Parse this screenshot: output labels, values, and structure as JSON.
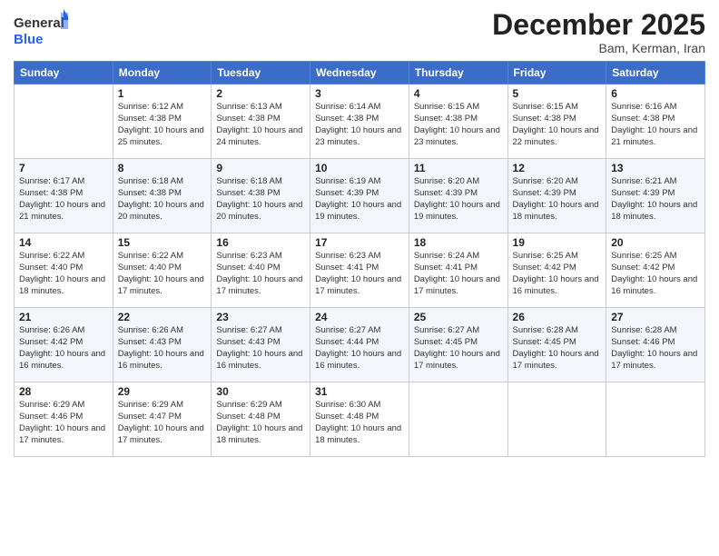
{
  "header": {
    "logo_line1": "General",
    "logo_line2": "Blue",
    "month_title": "December 2025",
    "location": "Bam, Kerman, Iran"
  },
  "weekdays": [
    "Sunday",
    "Monday",
    "Tuesday",
    "Wednesday",
    "Thursday",
    "Friday",
    "Saturday"
  ],
  "weeks": [
    [
      {
        "day": "",
        "sunrise": "",
        "sunset": "",
        "daylight": ""
      },
      {
        "day": "1",
        "sunrise": "6:12 AM",
        "sunset": "4:38 PM",
        "daylight": "10 hours and 25 minutes."
      },
      {
        "day": "2",
        "sunrise": "6:13 AM",
        "sunset": "4:38 PM",
        "daylight": "10 hours and 24 minutes."
      },
      {
        "day": "3",
        "sunrise": "6:14 AM",
        "sunset": "4:38 PM",
        "daylight": "10 hours and 23 minutes."
      },
      {
        "day": "4",
        "sunrise": "6:15 AM",
        "sunset": "4:38 PM",
        "daylight": "10 hours and 23 minutes."
      },
      {
        "day": "5",
        "sunrise": "6:15 AM",
        "sunset": "4:38 PM",
        "daylight": "10 hours and 22 minutes."
      },
      {
        "day": "6",
        "sunrise": "6:16 AM",
        "sunset": "4:38 PM",
        "daylight": "10 hours and 21 minutes."
      }
    ],
    [
      {
        "day": "7",
        "sunrise": "6:17 AM",
        "sunset": "4:38 PM",
        "daylight": "10 hours and 21 minutes."
      },
      {
        "day": "8",
        "sunrise": "6:18 AM",
        "sunset": "4:38 PM",
        "daylight": "10 hours and 20 minutes."
      },
      {
        "day": "9",
        "sunrise": "6:18 AM",
        "sunset": "4:38 PM",
        "daylight": "10 hours and 20 minutes."
      },
      {
        "day": "10",
        "sunrise": "6:19 AM",
        "sunset": "4:39 PM",
        "daylight": "10 hours and 19 minutes."
      },
      {
        "day": "11",
        "sunrise": "6:20 AM",
        "sunset": "4:39 PM",
        "daylight": "10 hours and 19 minutes."
      },
      {
        "day": "12",
        "sunrise": "6:20 AM",
        "sunset": "4:39 PM",
        "daylight": "10 hours and 18 minutes."
      },
      {
        "day": "13",
        "sunrise": "6:21 AM",
        "sunset": "4:39 PM",
        "daylight": "10 hours and 18 minutes."
      }
    ],
    [
      {
        "day": "14",
        "sunrise": "6:22 AM",
        "sunset": "4:40 PM",
        "daylight": "10 hours and 18 minutes."
      },
      {
        "day": "15",
        "sunrise": "6:22 AM",
        "sunset": "4:40 PM",
        "daylight": "10 hours and 17 minutes."
      },
      {
        "day": "16",
        "sunrise": "6:23 AM",
        "sunset": "4:40 PM",
        "daylight": "10 hours and 17 minutes."
      },
      {
        "day": "17",
        "sunrise": "6:23 AM",
        "sunset": "4:41 PM",
        "daylight": "10 hours and 17 minutes."
      },
      {
        "day": "18",
        "sunrise": "6:24 AM",
        "sunset": "4:41 PM",
        "daylight": "10 hours and 17 minutes."
      },
      {
        "day": "19",
        "sunrise": "6:25 AM",
        "sunset": "4:42 PM",
        "daylight": "10 hours and 16 minutes."
      },
      {
        "day": "20",
        "sunrise": "6:25 AM",
        "sunset": "4:42 PM",
        "daylight": "10 hours and 16 minutes."
      }
    ],
    [
      {
        "day": "21",
        "sunrise": "6:26 AM",
        "sunset": "4:42 PM",
        "daylight": "10 hours and 16 minutes."
      },
      {
        "day": "22",
        "sunrise": "6:26 AM",
        "sunset": "4:43 PM",
        "daylight": "10 hours and 16 minutes."
      },
      {
        "day": "23",
        "sunrise": "6:27 AM",
        "sunset": "4:43 PM",
        "daylight": "10 hours and 16 minutes."
      },
      {
        "day": "24",
        "sunrise": "6:27 AM",
        "sunset": "4:44 PM",
        "daylight": "10 hours and 16 minutes."
      },
      {
        "day": "25",
        "sunrise": "6:27 AM",
        "sunset": "4:45 PM",
        "daylight": "10 hours and 17 minutes."
      },
      {
        "day": "26",
        "sunrise": "6:28 AM",
        "sunset": "4:45 PM",
        "daylight": "10 hours and 17 minutes."
      },
      {
        "day": "27",
        "sunrise": "6:28 AM",
        "sunset": "4:46 PM",
        "daylight": "10 hours and 17 minutes."
      }
    ],
    [
      {
        "day": "28",
        "sunrise": "6:29 AM",
        "sunset": "4:46 PM",
        "daylight": "10 hours and 17 minutes."
      },
      {
        "day": "29",
        "sunrise": "6:29 AM",
        "sunset": "4:47 PM",
        "daylight": "10 hours and 17 minutes."
      },
      {
        "day": "30",
        "sunrise": "6:29 AM",
        "sunset": "4:48 PM",
        "daylight": "10 hours and 18 minutes."
      },
      {
        "day": "31",
        "sunrise": "6:30 AM",
        "sunset": "4:48 PM",
        "daylight": "10 hours and 18 minutes."
      },
      {
        "day": "",
        "sunrise": "",
        "sunset": "",
        "daylight": ""
      },
      {
        "day": "",
        "sunrise": "",
        "sunset": "",
        "daylight": ""
      },
      {
        "day": "",
        "sunrise": "",
        "sunset": "",
        "daylight": ""
      }
    ]
  ]
}
